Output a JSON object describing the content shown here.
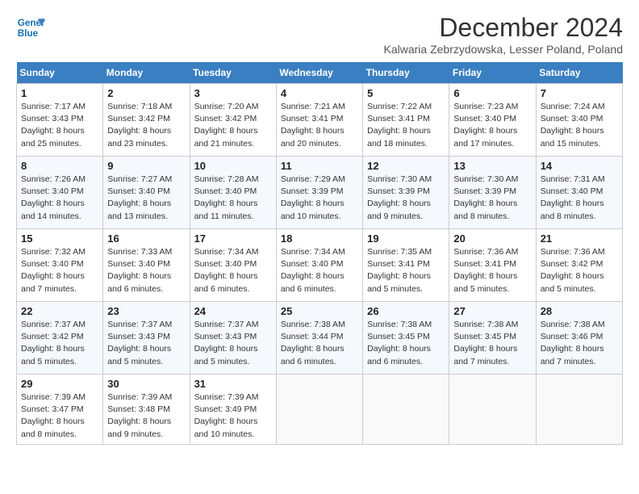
{
  "logo": {
    "line1": "General",
    "line2": "Blue"
  },
  "title": "December 2024",
  "subtitle": "Kalwaria Zebrzydowska, Lesser Poland, Poland",
  "days_header": [
    "Sunday",
    "Monday",
    "Tuesday",
    "Wednesday",
    "Thursday",
    "Friday",
    "Saturday"
  ],
  "weeks": [
    [
      {
        "day": "1",
        "sunrise": "7:17 AM",
        "sunset": "3:43 PM",
        "daylight": "8 hours and 25 minutes."
      },
      {
        "day": "2",
        "sunrise": "7:18 AM",
        "sunset": "3:42 PM",
        "daylight": "8 hours and 23 minutes."
      },
      {
        "day": "3",
        "sunrise": "7:20 AM",
        "sunset": "3:42 PM",
        "daylight": "8 hours and 21 minutes."
      },
      {
        "day": "4",
        "sunrise": "7:21 AM",
        "sunset": "3:41 PM",
        "daylight": "8 hours and 20 minutes."
      },
      {
        "day": "5",
        "sunrise": "7:22 AM",
        "sunset": "3:41 PM",
        "daylight": "8 hours and 18 minutes."
      },
      {
        "day": "6",
        "sunrise": "7:23 AM",
        "sunset": "3:40 PM",
        "daylight": "8 hours and 17 minutes."
      },
      {
        "day": "7",
        "sunrise": "7:24 AM",
        "sunset": "3:40 PM",
        "daylight": "8 hours and 15 minutes."
      }
    ],
    [
      {
        "day": "8",
        "sunrise": "7:26 AM",
        "sunset": "3:40 PM",
        "daylight": "8 hours and 14 minutes."
      },
      {
        "day": "9",
        "sunrise": "7:27 AM",
        "sunset": "3:40 PM",
        "daylight": "8 hours and 13 minutes."
      },
      {
        "day": "10",
        "sunrise": "7:28 AM",
        "sunset": "3:40 PM",
        "daylight": "8 hours and 11 minutes."
      },
      {
        "day": "11",
        "sunrise": "7:29 AM",
        "sunset": "3:39 PM",
        "daylight": "8 hours and 10 minutes."
      },
      {
        "day": "12",
        "sunrise": "7:30 AM",
        "sunset": "3:39 PM",
        "daylight": "8 hours and 9 minutes."
      },
      {
        "day": "13",
        "sunrise": "7:30 AM",
        "sunset": "3:39 PM",
        "daylight": "8 hours and 8 minutes."
      },
      {
        "day": "14",
        "sunrise": "7:31 AM",
        "sunset": "3:40 PM",
        "daylight": "8 hours and 8 minutes."
      }
    ],
    [
      {
        "day": "15",
        "sunrise": "7:32 AM",
        "sunset": "3:40 PM",
        "daylight": "8 hours and 7 minutes."
      },
      {
        "day": "16",
        "sunrise": "7:33 AM",
        "sunset": "3:40 PM",
        "daylight": "8 hours and 6 minutes."
      },
      {
        "day": "17",
        "sunrise": "7:34 AM",
        "sunset": "3:40 PM",
        "daylight": "8 hours and 6 minutes."
      },
      {
        "day": "18",
        "sunrise": "7:34 AM",
        "sunset": "3:40 PM",
        "daylight": "8 hours and 6 minutes."
      },
      {
        "day": "19",
        "sunrise": "7:35 AM",
        "sunset": "3:41 PM",
        "daylight": "8 hours and 5 minutes."
      },
      {
        "day": "20",
        "sunrise": "7:36 AM",
        "sunset": "3:41 PM",
        "daylight": "8 hours and 5 minutes."
      },
      {
        "day": "21",
        "sunrise": "7:36 AM",
        "sunset": "3:42 PM",
        "daylight": "8 hours and 5 minutes."
      }
    ],
    [
      {
        "day": "22",
        "sunrise": "7:37 AM",
        "sunset": "3:42 PM",
        "daylight": "8 hours and 5 minutes."
      },
      {
        "day": "23",
        "sunrise": "7:37 AM",
        "sunset": "3:43 PM",
        "daylight": "8 hours and 5 minutes."
      },
      {
        "day": "24",
        "sunrise": "7:37 AM",
        "sunset": "3:43 PM",
        "daylight": "8 hours and 5 minutes."
      },
      {
        "day": "25",
        "sunrise": "7:38 AM",
        "sunset": "3:44 PM",
        "daylight": "8 hours and 6 minutes."
      },
      {
        "day": "26",
        "sunrise": "7:38 AM",
        "sunset": "3:45 PM",
        "daylight": "8 hours and 6 minutes."
      },
      {
        "day": "27",
        "sunrise": "7:38 AM",
        "sunset": "3:45 PM",
        "daylight": "8 hours and 7 minutes."
      },
      {
        "day": "28",
        "sunrise": "7:38 AM",
        "sunset": "3:46 PM",
        "daylight": "8 hours and 7 minutes."
      }
    ],
    [
      {
        "day": "29",
        "sunrise": "7:39 AM",
        "sunset": "3:47 PM",
        "daylight": "8 hours and 8 minutes."
      },
      {
        "day": "30",
        "sunrise": "7:39 AM",
        "sunset": "3:48 PM",
        "daylight": "8 hours and 9 minutes."
      },
      {
        "day": "31",
        "sunrise": "7:39 AM",
        "sunset": "3:49 PM",
        "daylight": "8 hours and 10 minutes."
      },
      null,
      null,
      null,
      null
    ]
  ]
}
